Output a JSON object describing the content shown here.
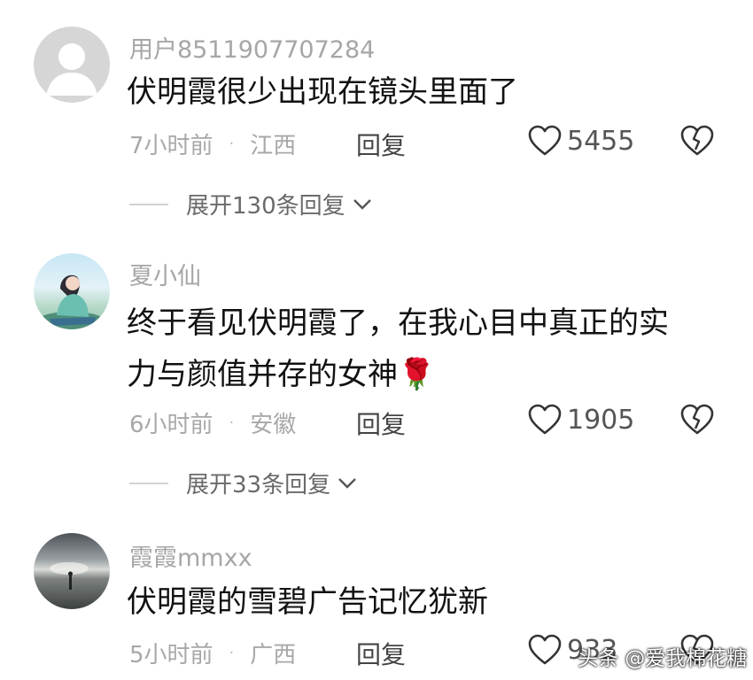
{
  "comments": [
    {
      "username": "用户8511907707284",
      "text": "伏明霞很少出现在镜头里面了",
      "time": "7小时前",
      "separator": "·",
      "location": "江西",
      "reply_label": "回复",
      "likes": "5455",
      "expand_label": "展开130条回复"
    },
    {
      "username": "夏小仙",
      "text": "终于看见伏明霞了，在我心目中真正的实力与颜值并存的女神🌹",
      "time": "6小时前",
      "separator": "·",
      "location": "安徽",
      "reply_label": "回复",
      "likes": "1905",
      "expand_label": "展开33条回复"
    },
    {
      "username": "霞霞mmxx",
      "text": "伏明霞的雪碧广告记忆犹新",
      "time": "5小时前",
      "separator": "·",
      "location": "广西",
      "reply_label": "回复",
      "likes": "933"
    }
  ],
  "watermark": "头条 @爱我棉花糖",
  "icons": {
    "like": "heart-outline-icon",
    "dislike": "broken-heart-icon",
    "expand": "chevron-down-icon"
  }
}
